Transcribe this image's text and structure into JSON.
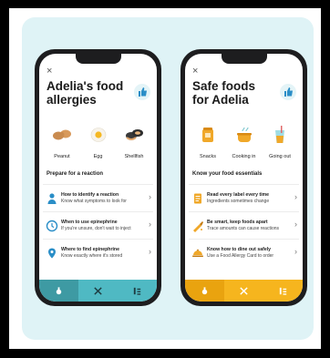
{
  "colors": {
    "teal": "#4fb9c3",
    "teal_dark": "#3e9aa3",
    "yellow": "#f6b51e",
    "yellow_dark": "#e9a30f",
    "blue": "#2a8ec7"
  },
  "left_phone": {
    "close": "×",
    "title": "Adelia's food allergies",
    "allergens": [
      {
        "label": "Peanut",
        "icon": "peanut-icon"
      },
      {
        "label": "Egg",
        "icon": "egg-icon"
      },
      {
        "label": "Shellfish",
        "icon": "shellfish-icon"
      }
    ],
    "section_title": "Prepare for a reaction",
    "rows": [
      {
        "title": "How to identify a reaction",
        "subtitle": "Know what symptoms to look for",
        "icon": "person-icon"
      },
      {
        "title": "When to use epinephrine",
        "subtitle": "If you're unsure, don't wait to inject",
        "icon": "clock-icon"
      },
      {
        "title": "Where to find epinephrine",
        "subtitle": "Know exactly where it's stored",
        "icon": "location-pin-icon"
      }
    ],
    "tabs": [
      "home-tab-icon",
      "utensils-tab-icon",
      "menu-tab-icon"
    ]
  },
  "right_phone": {
    "close": "×",
    "title": "Safe foods for Adelia",
    "categories": [
      {
        "label": "Snacks",
        "icon": "snacks-icon"
      },
      {
        "label": "Cooking in",
        "icon": "cooking-icon"
      },
      {
        "label": "Going out",
        "icon": "drink-icon"
      }
    ],
    "section_title": "Know your food essentials",
    "rows": [
      {
        "title": "Read every label every time",
        "subtitle": "Ingredients sometimes change",
        "icon": "label-icon"
      },
      {
        "title": "Be smart, keep foods apart",
        "subtitle": "Trace amounts can cause reactions",
        "icon": "knife-icon"
      },
      {
        "title": "Know how to dine out safely",
        "subtitle": "Use a Food Allergy Card to order",
        "icon": "dish-icon"
      }
    ],
    "tabs": [
      "home-tab-icon",
      "utensils-tab-icon",
      "menu-tab-icon"
    ]
  }
}
